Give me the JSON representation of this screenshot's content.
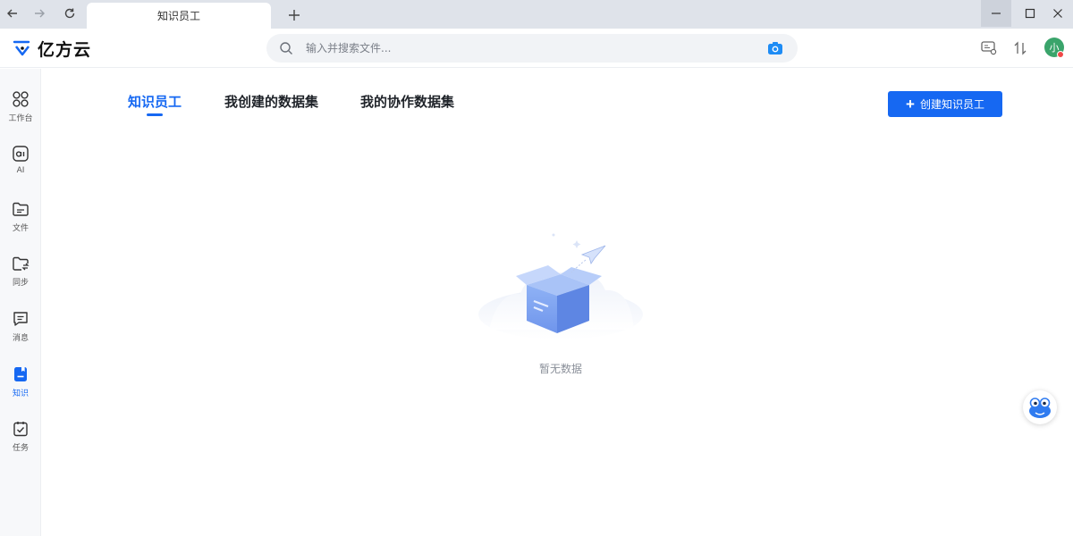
{
  "browser": {
    "tab_title": "知识员工",
    "new_tab_symbol": "+"
  },
  "header": {
    "logo_text": "亿方云",
    "search_placeholder": "输入并搜索文件...",
    "avatar_text": "小"
  },
  "sidebar": {
    "items": [
      {
        "label": "工作台",
        "icon": "grid-icon"
      },
      {
        "label": "AI",
        "icon": "ai-icon"
      },
      {
        "label": "文件",
        "icon": "folder-icon"
      },
      {
        "label": "同步",
        "icon": "sync-folder-icon"
      },
      {
        "label": "消息",
        "icon": "message-icon"
      },
      {
        "label": "知识",
        "icon": "knowledge-icon",
        "active": true
      },
      {
        "label": "任务",
        "icon": "task-icon"
      }
    ]
  },
  "main": {
    "tabs": [
      {
        "label": "知识员工",
        "active": true
      },
      {
        "label": "我创建的数据集"
      },
      {
        "label": "我的协作数据集"
      }
    ],
    "create_button_label": "创建知识员工",
    "empty_text": "暂无数据"
  },
  "colors": {
    "accent": "#1668f2",
    "sidebar_bg": "#f7f8fa",
    "titlebar_bg": "#dfe3ea"
  }
}
